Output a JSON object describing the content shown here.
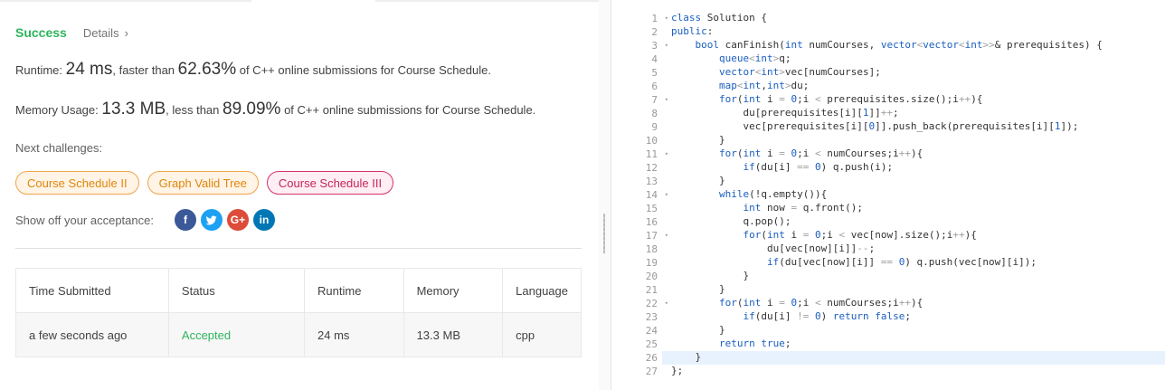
{
  "result": {
    "status": "Success",
    "details_label": "Details",
    "details_chevron": "›",
    "runtime": {
      "prefix": "Runtime: ",
      "value": "24 ms",
      "mid": ", faster than ",
      "percent": "62.63%",
      "suffix": " of C++ online submissions for Course Schedule."
    },
    "memory": {
      "prefix": "Memory Usage: ",
      "value": "13.3 MB",
      "mid": ", less than ",
      "percent": "89.09%",
      "suffix": " of C++ online submissions for Course Schedule."
    }
  },
  "next": {
    "label": "Next challenges:",
    "chips": [
      {
        "label": "Course Schedule II",
        "difficulty": "medium"
      },
      {
        "label": "Graph Valid Tree",
        "difficulty": "medium"
      },
      {
        "label": "Course Schedule III",
        "difficulty": "hard"
      }
    ]
  },
  "share": {
    "label": "Show off your acceptance:",
    "icons": [
      {
        "name": "facebook-icon",
        "glyph": "f",
        "color": "#3b5998"
      },
      {
        "name": "twitter-icon",
        "glyph": "t",
        "color": "#1da1f2"
      },
      {
        "name": "google-plus-icon",
        "glyph": "G+",
        "color": "#dd4b39"
      },
      {
        "name": "linkedin-icon",
        "glyph": "in",
        "color": "#0077b5"
      }
    ]
  },
  "submissions": {
    "headers": [
      "Time Submitted",
      "Status",
      "Runtime",
      "Memory",
      "Language"
    ],
    "rows": [
      [
        "a few seconds ago",
        "Accepted",
        "24 ms",
        "13.3 MB",
        "cpp"
      ]
    ]
  },
  "editor": {
    "active_line": 26,
    "fold_lines": [
      1,
      3,
      7,
      11,
      14,
      17,
      22
    ],
    "lines": [
      "class Solution {",
      "public:",
      "    bool canFinish(int numCourses, vector<vector<int>>& prerequisites) {",
      "        queue<int>q;",
      "        vector<int>vec[numCourses];",
      "        map<int,int>du;",
      "        for(int i = 0;i < prerequisites.size();i++){",
      "            du[prerequisites[i][1]]++;",
      "            vec[prerequisites[i][0]].push_back(prerequisites[i][1]);",
      "        }",
      "        for(int i = 0;i < numCourses;i++){",
      "            if(du[i] == 0) q.push(i);",
      "        }",
      "        while(!q.empty()){",
      "            int now = q.front();",
      "            q.pop();",
      "            for(int i = 0;i < vec[now].size();i++){",
      "                du[vec[now][i]]--;",
      "                if(du[vec[now][i]] == 0) q.push(vec[now][i]);",
      "            }",
      "        }",
      "        for(int i = 0;i < numCourses;i++){",
      "            if(du[i] != 0) return false;",
      "        }",
      "        return true;",
      "    }",
      "};"
    ]
  },
  "colors": {
    "success": "#2db55d",
    "medium": "#e0860e",
    "hard": "#c2255c",
    "keyword": "#1a5ebf"
  }
}
